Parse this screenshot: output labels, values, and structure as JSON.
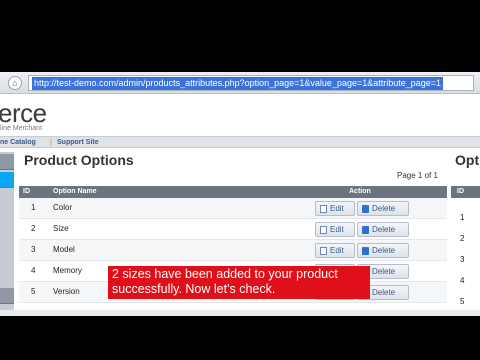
{
  "browser": {
    "url": "http://test-demo.com/admin/products_attributes.php?option_page=1&value_page=1&attribute_page=1"
  },
  "header": {
    "logo": "erce",
    "logo_sub": "line Merchant"
  },
  "nav": {
    "catalog": "ne Catalog",
    "separator": "|",
    "support": "Support Site"
  },
  "main": {
    "title": "Product Options",
    "page_info": "Page 1 of 1",
    "columns": {
      "id": "ID",
      "name": "Option Name",
      "action": "Action"
    },
    "rows": [
      {
        "id": "1",
        "name": "Color"
      },
      {
        "id": "2",
        "name": "Size"
      },
      {
        "id": "3",
        "name": "Model"
      },
      {
        "id": "4",
        "name": "Memory"
      },
      {
        "id": "5",
        "name": "Version"
      }
    ],
    "edit_label": "Edit",
    "delete_label": "Delete"
  },
  "right_panel": {
    "title": "Opti",
    "head_id": "ID",
    "ids": [
      "1",
      "2",
      "3",
      "4",
      "5"
    ]
  },
  "notice": {
    "text": "2 sizes have been added to your product successfully. Now let's check."
  },
  "colors": {
    "notice_bg": "#e0101a",
    "url_highlight": "#3d72d8",
    "table_header": "#6b7480",
    "sidebar_active": "#0aa8f0"
  }
}
